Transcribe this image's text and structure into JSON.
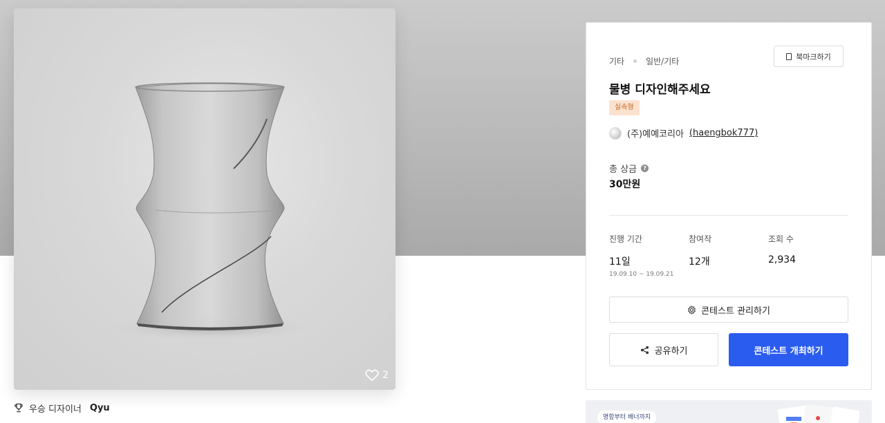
{
  "product_image": {
    "alt": "물병 디자인",
    "like_count": "2",
    "icons": {
      "like": "heart-icon"
    }
  },
  "winner": {
    "label": "우승 디자이너",
    "name": "Qyu",
    "icon": "trophy-icon"
  },
  "contest": {
    "breadcrumb": [
      "기타",
      "일반/기타"
    ],
    "bookmark_label": "북마크하기",
    "title": "물병 디자인해주세요",
    "badge": "실속형",
    "host_name": "(주)예예코리아",
    "host_id": "haengbok777",
    "prize_label": "총 상금",
    "prize_value": "30만원",
    "stats": [
      {
        "label": "진행 기간",
        "value": "11일",
        "sub": "19.09.10 ~ 19.09.21"
      },
      {
        "label": "참여작",
        "value": "12개",
        "sub": ""
      },
      {
        "label": "조회 수",
        "value": "2,934",
        "sub": ""
      }
    ],
    "manage_label": "콘테스트 관리하기",
    "share_label": "공유하기",
    "open_label": "콘테스트 개최하기"
  },
  "banner": {
    "pill_text": "명함부터 배너까지"
  },
  "colors": {
    "primary": "#2b5cf0",
    "badge_bg": "#fbe2cf",
    "badge_text": "#c26a2a",
    "hero_band": "#b9b9b9"
  }
}
